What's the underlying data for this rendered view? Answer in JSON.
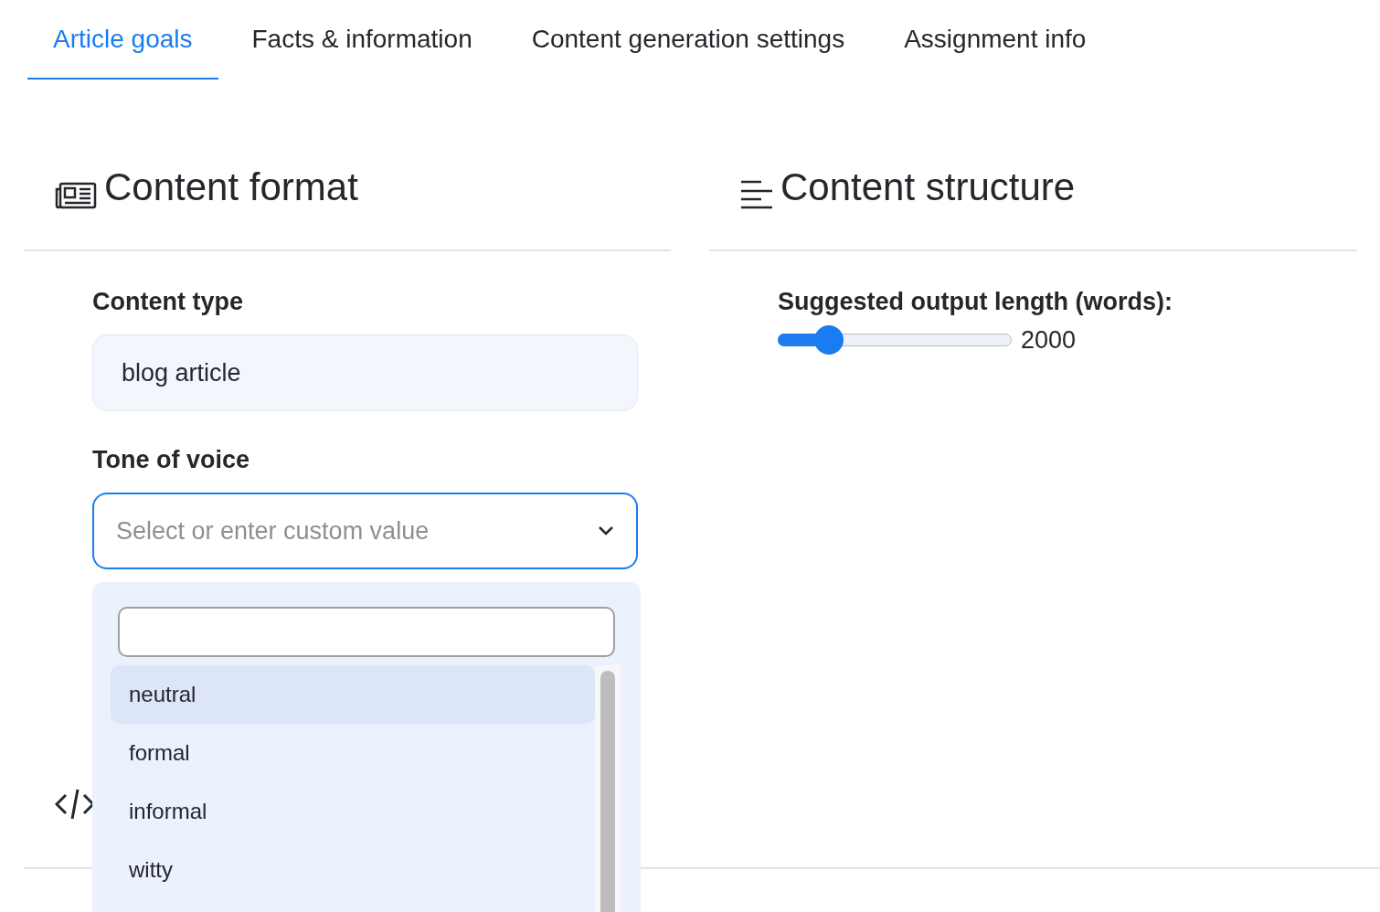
{
  "tabs": [
    {
      "label": "Article goals",
      "selected": true
    },
    {
      "label": "Facts & information",
      "selected": false
    },
    {
      "label": "Content generation settings",
      "selected": false
    },
    {
      "label": "Assignment info",
      "selected": false
    }
  ],
  "content_format": {
    "title": "Content format",
    "fields": [
      {
        "kind": "text",
        "label": "Content type",
        "value": "blog article"
      },
      {
        "kind": "select",
        "label": "Tone of voice",
        "placeholder": "Select or enter custom value",
        "expanded": true,
        "options": [
          {
            "label": "neutral",
            "selected": true
          },
          {
            "label": "formal",
            "selected": false
          },
          {
            "label": "informal",
            "selected": false
          },
          {
            "label": "witty",
            "selected": false
          }
        ]
      }
    ]
  },
  "content_structure": {
    "title": "Content structure",
    "slider": {
      "label": "Suggested output length (words):",
      "level": 0.22,
      "reading": "2000"
    }
  }
}
